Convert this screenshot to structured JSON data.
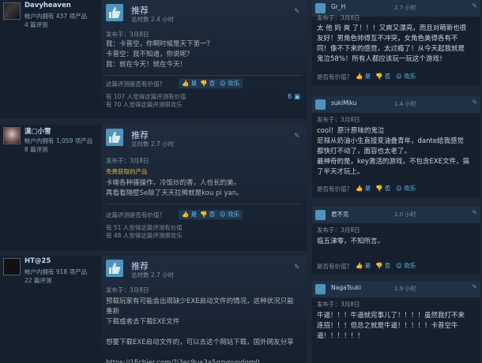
{
  "reviews": [
    {
      "author": "Davyheaven",
      "meta1": "帐户内拥有 437 项产品",
      "meta2": "4 篇评测",
      "rec": "推荐",
      "hours": "总时数 2.4 小时",
      "date": "发布于：3月8日",
      "free": "",
      "text": "我：卡普空，你啊时候是天下第一？\n卡普空：我不知道，你说呢？\n我：就在今天！就在今天！",
      "helpful_q": "这篇评测是否有价值？",
      "yes": "是",
      "no": "否",
      "funny": "欢乐",
      "stats": "有 107 人觉得这篇评测有价值\n有 70 人觉得这篇评测很欢乐",
      "comments": "6"
    },
    {
      "author": "漠□小雪",
      "meta1": "帐户内拥有 1,059 项产品",
      "meta2": "8 篇评测",
      "rec": "推荐",
      "hours": "总时数 2.7 小时",
      "date": "发布于：3月8日",
      "free": "免费获取的产品",
      "text": "卡嗟各种骚操作，冷饭炒的香，人也长的美。\n再看看隔壁Se除了天天拉稀就是kou pi yan。",
      "helpful_q": "这篇评测是否有价值？",
      "yes": "是",
      "no": "否",
      "funny": "欢乐",
      "stats": "有 51 人觉得这篇评测有价值\n有 48 人觉得这篇评测很欢乐",
      "comments": ""
    },
    {
      "author": "HT@25",
      "meta1": "帐户内拥有 918 项产品",
      "meta2": "22 篇评测",
      "rec": "推荐",
      "hours": "总时数 2.7 小时",
      "date": "发布于：3月8日",
      "free": "",
      "text": "预载玩家有可能会出现缺少EXE启动文件的情况，这种状况只能重新\n下载或者去下载EXE文件\n\n想要下载EXE启动文件的，可以去这个网站下载，国外网友分享\n\nhttps://1fichier.com/?j3ec9ux3a5qzypvpdgm0",
      "helpful_q": "",
      "yes": "",
      "no": "",
      "funny": "",
      "stats": "",
      "comments": ""
    }
  ],
  "side": [
    {
      "name": "Gr_H",
      "hours": "2.7 小时",
      "date": "发布于：3月8日",
      "text": "太 他 妈 爽 了！！！又爽又漂亮，而且对萌新也很\n友好！男角色帅得互不冲突，女角色美得各有不\n同！像不下来的感觉，太过瘾了！从今天起我就是\n鬼泣58%！所有人都应该玩一玩这个游戏！",
      "help": "是否有价值？",
      "yes": "是",
      "no": "否",
      "funny": "欢乐"
    },
    {
      "name": "sukiMiku",
      "hours": "1.4 小时",
      "date": "发布于：3月8日",
      "text": "cool！原汁原味的鬼泣\n尼禄从奶油小生直接变油叠青年，dante给我感觉\n都快打不动了，面容也太老了。\n最神奇的是，key激活的游戏，不包含EXE文件，搞\n了半天才玩上。",
      "help": "是否有价值？",
      "yes": "是",
      "no": "否",
      "funny": "欢乐"
    },
    {
      "name": "君不见",
      "hours": "1.0 小时",
      "date": "发布于：3月8日",
      "text": "临五涕零，不知所言。",
      "help": "是否有价值？",
      "yes": "是",
      "no": "否",
      "funny": "欢乐"
    },
    {
      "name": "NagaTsuki",
      "hours": "1.9 小时",
      "date": "发布于：3月8日",
      "text": "牛逼！！！牛逼就完事儿了！！！！虽然我打不来\n连招！！！但总之就是牛逼！！！！！卡普空牛\n逼！！！！！！",
      "help": "",
      "yes": "",
      "no": "",
      "funny": ""
    }
  ]
}
